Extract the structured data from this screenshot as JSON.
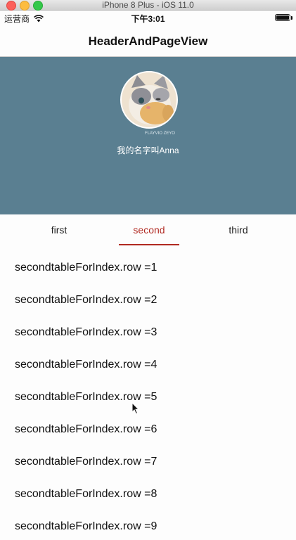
{
  "simulator": {
    "title": "iPhone 8 Plus - iOS 11.0"
  },
  "status_bar": {
    "carrier": "运营商",
    "time": "下午3:01",
    "wifi_icon": "wifi-icon",
    "battery_icon": "battery-icon",
    "battery_level": 1.0
  },
  "nav": {
    "title": "HeaderAndPageView"
  },
  "header": {
    "background_color": "#5a7f91",
    "avatar_watermark": "FLAYVIO ZEYO",
    "name": "我的名字叫Anna"
  },
  "tabs": {
    "accent_color": "#b12a22",
    "selected": "second",
    "items": [
      {
        "label": "first"
      },
      {
        "label": "second"
      },
      {
        "label": "third"
      }
    ]
  },
  "list": {
    "rows": [
      "secondtableForIndex.row =1",
      "secondtableForIndex.row =2",
      "secondtableForIndex.row =3",
      "secondtableForIndex.row =4",
      "secondtableForIndex.row =5",
      "secondtableForIndex.row =6",
      "secondtableForIndex.row =7",
      "secondtableForIndex.row =8",
      "secondtableForIndex.row =9"
    ]
  },
  "cursor_icon": "mouse-pointer-icon"
}
